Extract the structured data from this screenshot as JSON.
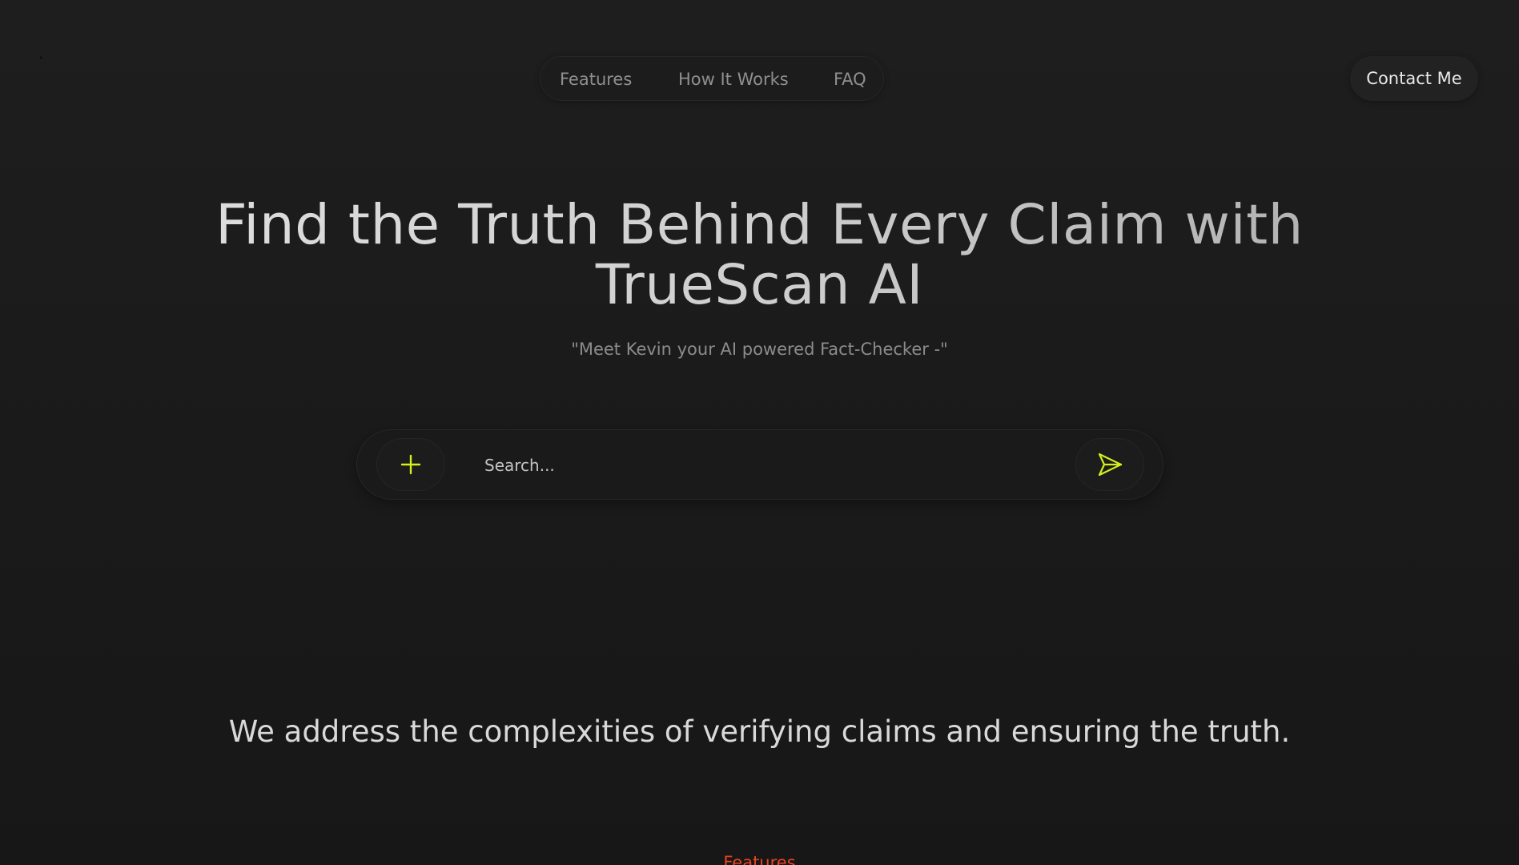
{
  "nav": {
    "items": [
      {
        "label": "Features"
      },
      {
        "label": "How It Works"
      },
      {
        "label": "FAQ"
      }
    ],
    "contact_label": "Contact Me"
  },
  "hero": {
    "title_line1": "Find the Truth Behind Every Claim with",
    "title_line2": "TrueScan AI",
    "subtitle": "\"Meet Kevin your AI powered Fact-Checker -\""
  },
  "search": {
    "placeholder": "Search...",
    "value": "",
    "add_icon": "plus-icon",
    "send_icon": "send-icon"
  },
  "tagline": "We address the complexities of verifying claims and ensuring the truth.",
  "section_label": "Features",
  "colors": {
    "background": "#1b1b1b",
    "accent_lime": "#d4f01c",
    "accent_orange": "#e8451e",
    "nav_text": "#8f8f8f"
  }
}
